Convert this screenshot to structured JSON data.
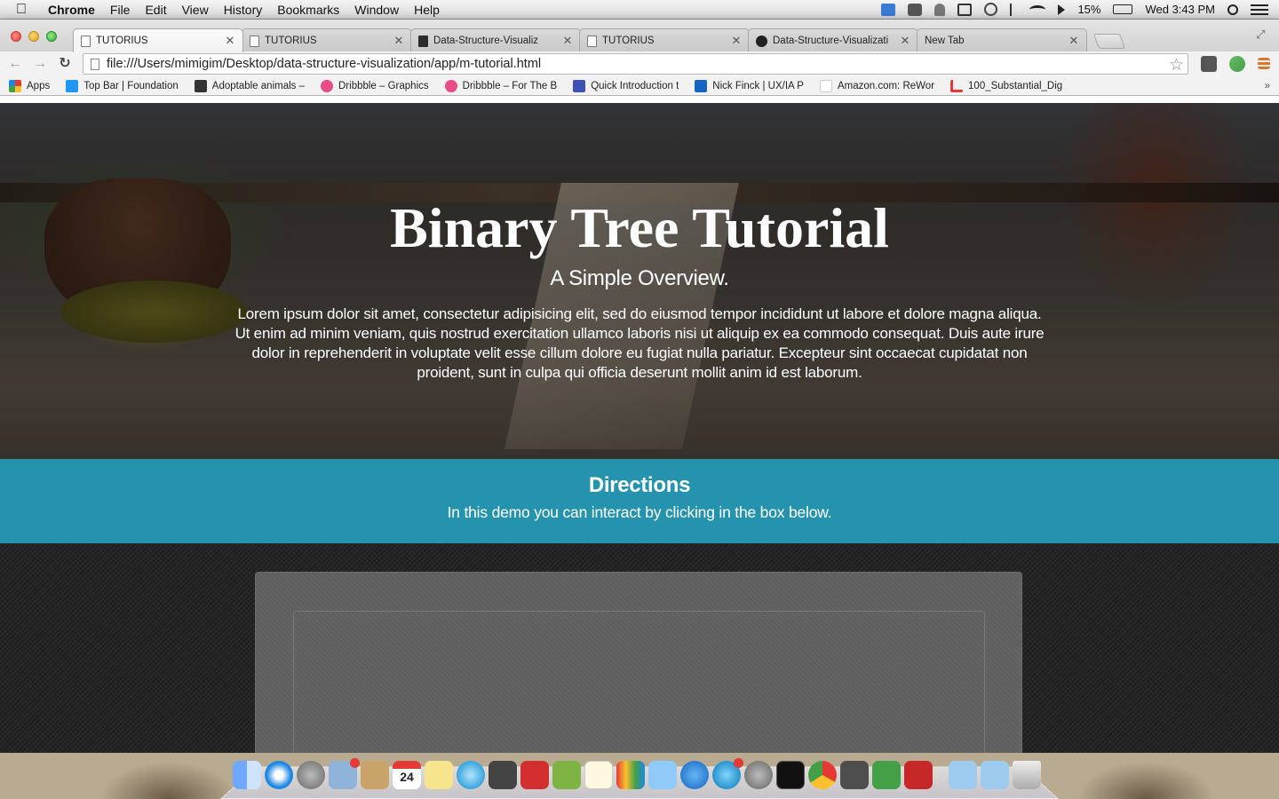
{
  "menubar": {
    "app_name": "Chrome",
    "menus": [
      "File",
      "Edit",
      "View",
      "History",
      "Bookmarks",
      "Window",
      "Help"
    ],
    "battery": "15%",
    "clock": "Wed 3:43 PM"
  },
  "tabs": [
    {
      "title": "TUTORIUS",
      "active": true,
      "icon": "page-icon"
    },
    {
      "title": "TUTORIUS",
      "active": false,
      "icon": "page-icon"
    },
    {
      "title": "Data-Structure-Visualiz",
      "active": false,
      "icon": "app-icon"
    },
    {
      "title": "TUTORIUS",
      "active": false,
      "icon": "page-icon"
    },
    {
      "title": "Data-Structure-Visualizati",
      "active": false,
      "icon": "github-icon"
    },
    {
      "title": "New Tab",
      "active": false,
      "icon": "none"
    }
  ],
  "address_bar": {
    "url": "file:///Users/mimigim/Desktop/data-structure-visualization/app/m-tutorial.html"
  },
  "bookmarks": [
    {
      "label": "Apps",
      "icon": "apps-icon"
    },
    {
      "label": "Top Bar | Foundation",
      "icon": "foundation-icon"
    },
    {
      "label": "Adoptable animals –",
      "icon": "paw-icon"
    },
    {
      "label": "Dribbble – Graphics",
      "icon": "dribbble-icon"
    },
    {
      "label": "Dribbble – For The B",
      "icon": "dribbble-icon"
    },
    {
      "label": "Quick Introduction t",
      "icon": "m-icon"
    },
    {
      "label": "Nick Finck | UX/IA P",
      "icon": "n-icon"
    },
    {
      "label": "Amazon.com: ReWor",
      "icon": "amazon-icon"
    },
    {
      "label": "100_Substantial_Dig",
      "icon": "pdf-icon"
    }
  ],
  "hero": {
    "title": "Binary Tree Tutorial",
    "subtitle": "A Simple Overview.",
    "body": "Lorem ipsum dolor sit amet, consectetur adipisicing elit, sed do eiusmod tempor incididunt ut labore et dolore magna aliqua. Ut enim ad minim veniam, quis nostrud exercitation ullamco laboris nisi ut aliquip ex ea commodo consequat. Duis aute irure dolor in reprehenderit in voluptate velit esse cillum dolore eu fugiat nulla pariatur. Excepteur sint occaecat cupidatat non proident, sunt in culpa qui officia deserunt mollit anim id est laborum."
  },
  "directions": {
    "title": "Directions",
    "text": "In this demo you can interact by clicking in the box below."
  },
  "colors": {
    "directions_bg": "#2593ae",
    "demo_bg": "#262626",
    "demo_box": "#5e5e5e"
  },
  "dock": {
    "calendar_day": "24",
    "apps": [
      "finder-icon",
      "safari-icon",
      "launchpad-icon",
      "mail-stamp-icon",
      "contacts-icon",
      "calendar-icon",
      "notes-icon",
      "messages-icon",
      "facetime-icon",
      "photo-booth-icon",
      "iphoto-icon",
      "textedit-icon",
      "chart-app-icon",
      "keynote-icon",
      "itunes-icon",
      "app-store-icon",
      "system-preferences-icon",
      "terminal-icon",
      "chrome-icon",
      "sublime-icon",
      "evernote-icon",
      "acrobat-icon",
      "folder-icon",
      "folder-icon",
      "trash-icon"
    ]
  }
}
